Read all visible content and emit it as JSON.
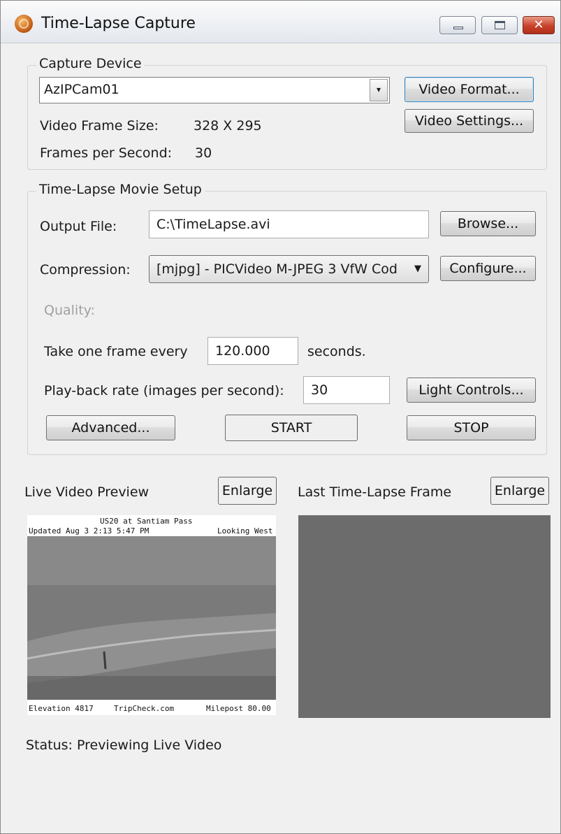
{
  "window": {
    "title": "Time-Lapse Capture",
    "controls": {
      "close_glyph": "✕"
    }
  },
  "capture_device": {
    "group_label": "Capture Device",
    "device": "AzIPCam01",
    "video_format_btn": "Video Format...",
    "video_settings_btn": "Video Settings...",
    "frame_size_label": "Video Frame Size:",
    "frame_size_value": "328 X 295",
    "fps_label": "Frames per Second:",
    "fps_value": "30"
  },
  "movie_setup": {
    "group_label": "Time-Lapse Movie Setup",
    "output_label": "Output File:",
    "output_value": "C:\\TimeLapse.avi",
    "browse_btn": "Browse...",
    "compression_label": "Compression:",
    "compression_value": "[mjpg] - PICVideo M-JPEG 3 VfW Cod",
    "configure_btn": "Configure...",
    "quality_label": "Quality:",
    "interval_prefix": "Take one frame every",
    "interval_value": "120.000",
    "interval_suffix": "seconds.",
    "playback_label": "Play-back rate (images per second):",
    "playback_value": "30",
    "light_controls_btn": "Light Controls...",
    "advanced_btn": "Advanced...",
    "start_btn": "START",
    "stop_btn": "STOP"
  },
  "live_preview": {
    "label": "Live Video Preview",
    "enlarge_btn": "Enlarge",
    "overlay_title": "US20 at Santiam Pass",
    "overlay_left": "Updated Aug 3 2:13 5:47 PM",
    "overlay_right": "Looking West",
    "overlay_bottom_left": "Elevation 4817",
    "overlay_bottom_center": "TripCheck.com",
    "overlay_bottom_right": "Milepost 80.00"
  },
  "last_frame": {
    "label": "Last Time-Lapse Frame",
    "enlarge_btn": "Enlarge"
  },
  "status": {
    "text": "Status: Previewing Live Video"
  },
  "icons": {
    "app": "camera-aperture-icon",
    "combo_arrow": "▾",
    "dropdown_arrow": "▼"
  }
}
